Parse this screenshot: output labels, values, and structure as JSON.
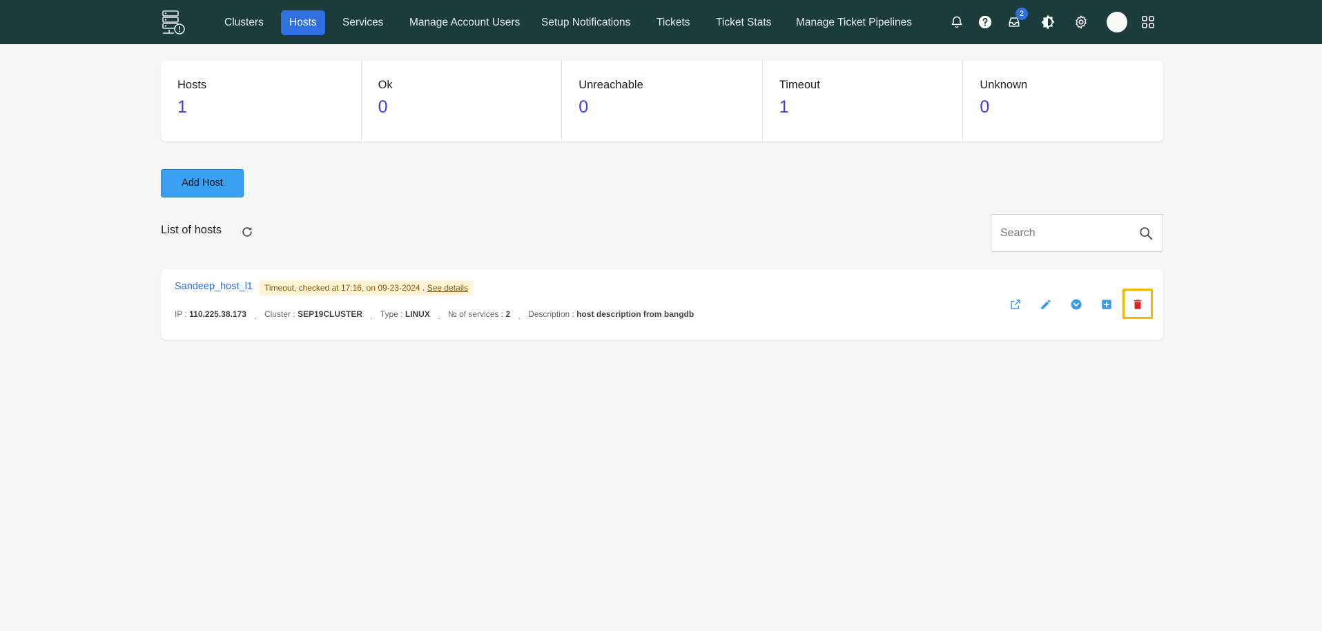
{
  "nav": {
    "items": [
      {
        "label": "Clusters"
      },
      {
        "label": "Hosts"
      },
      {
        "label": "Services"
      },
      {
        "label": "Manage Account Users"
      },
      {
        "label": "Setup Notifications"
      },
      {
        "label": "Tickets"
      },
      {
        "label": "Ticket Stats"
      },
      {
        "label": "Manage Ticket Pipelines"
      }
    ],
    "active": "Hosts",
    "inbox_badge": "2",
    "icons": [
      "bell-icon",
      "help-icon",
      "inbox-icon",
      "theme-icon",
      "gear-icon",
      "avatar",
      "apps-grid-icon"
    ]
  },
  "stats": [
    {
      "label": "Hosts",
      "value": "1"
    },
    {
      "label": "Ok",
      "value": "0"
    },
    {
      "label": "Unreachable",
      "value": "0"
    },
    {
      "label": "Timeout",
      "value": "1"
    },
    {
      "label": "Unknown",
      "value": "0"
    }
  ],
  "add_host_label": "Add Host",
  "list": {
    "title": "List of hosts",
    "search_placeholder": "Search"
  },
  "host": {
    "name": "Sandeep_host_l1",
    "status_text": "Timeout, checked at 17:16, on 09-23-2024 .",
    "see_details": "See details",
    "ip_label": "IP :",
    "ip": "110.225.38.173",
    "cluster_label": "Cluster :",
    "cluster": "SEP19CLUSTER",
    "type_label": "Type :",
    "type": "LINUX",
    "services_label": "№ of services :",
    "services": "2",
    "description_label": "Description :",
    "description": "host description from bangdb"
  },
  "colors": {
    "nav_bg": "#1c3b3b",
    "active_tab": "#2f6fe0",
    "stat_value": "#3b3fe0",
    "add_button": "#3aa0f0",
    "action_blue": "#3a9ce8",
    "delete_red": "#d62828",
    "highlight": "#f5b800"
  }
}
